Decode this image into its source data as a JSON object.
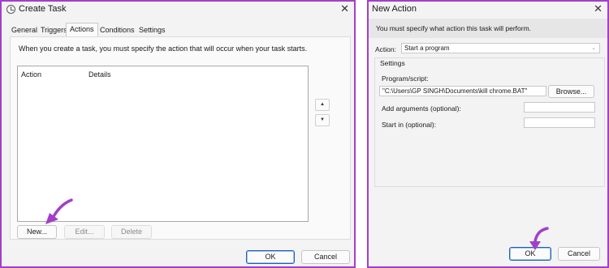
{
  "create_task": {
    "title": "Create Task",
    "tabs": [
      "General",
      "Triggers",
      "Actions",
      "Conditions",
      "Settings"
    ],
    "active_tab": "Actions",
    "description": "When you create a task, you must specify the action that will occur when your task starts.",
    "columns": {
      "action": "Action",
      "details": "Details"
    },
    "buttons": {
      "new": "New...",
      "edit": "Edit...",
      "delete": "Delete",
      "ok": "OK",
      "cancel": "Cancel"
    },
    "close_glyph": "✕",
    "scroll_up": "▲",
    "scroll_down": "▼"
  },
  "new_action": {
    "title": "New Action",
    "header": "You must specify what action this task will perform.",
    "action_label": "Action:",
    "action_value": "Start a program",
    "settings_label": "Settings",
    "program_label": "Program/script:",
    "program_value": "\"C:\\Users\\GP SINGH\\Documents\\kill chrome.BAT\"",
    "browse": "Browse...",
    "args_label": "Add arguments (optional):",
    "args_value": "",
    "startin_label": "Start in (optional):",
    "startin_value": "",
    "ok": "OK",
    "cancel": "Cancel",
    "close_glyph": "✕",
    "chevron": "⌄"
  },
  "colors": {
    "annotation_arrow": "#a23fc9",
    "window_border": "#a23fc9",
    "primary_border": "#1f5fb8"
  }
}
